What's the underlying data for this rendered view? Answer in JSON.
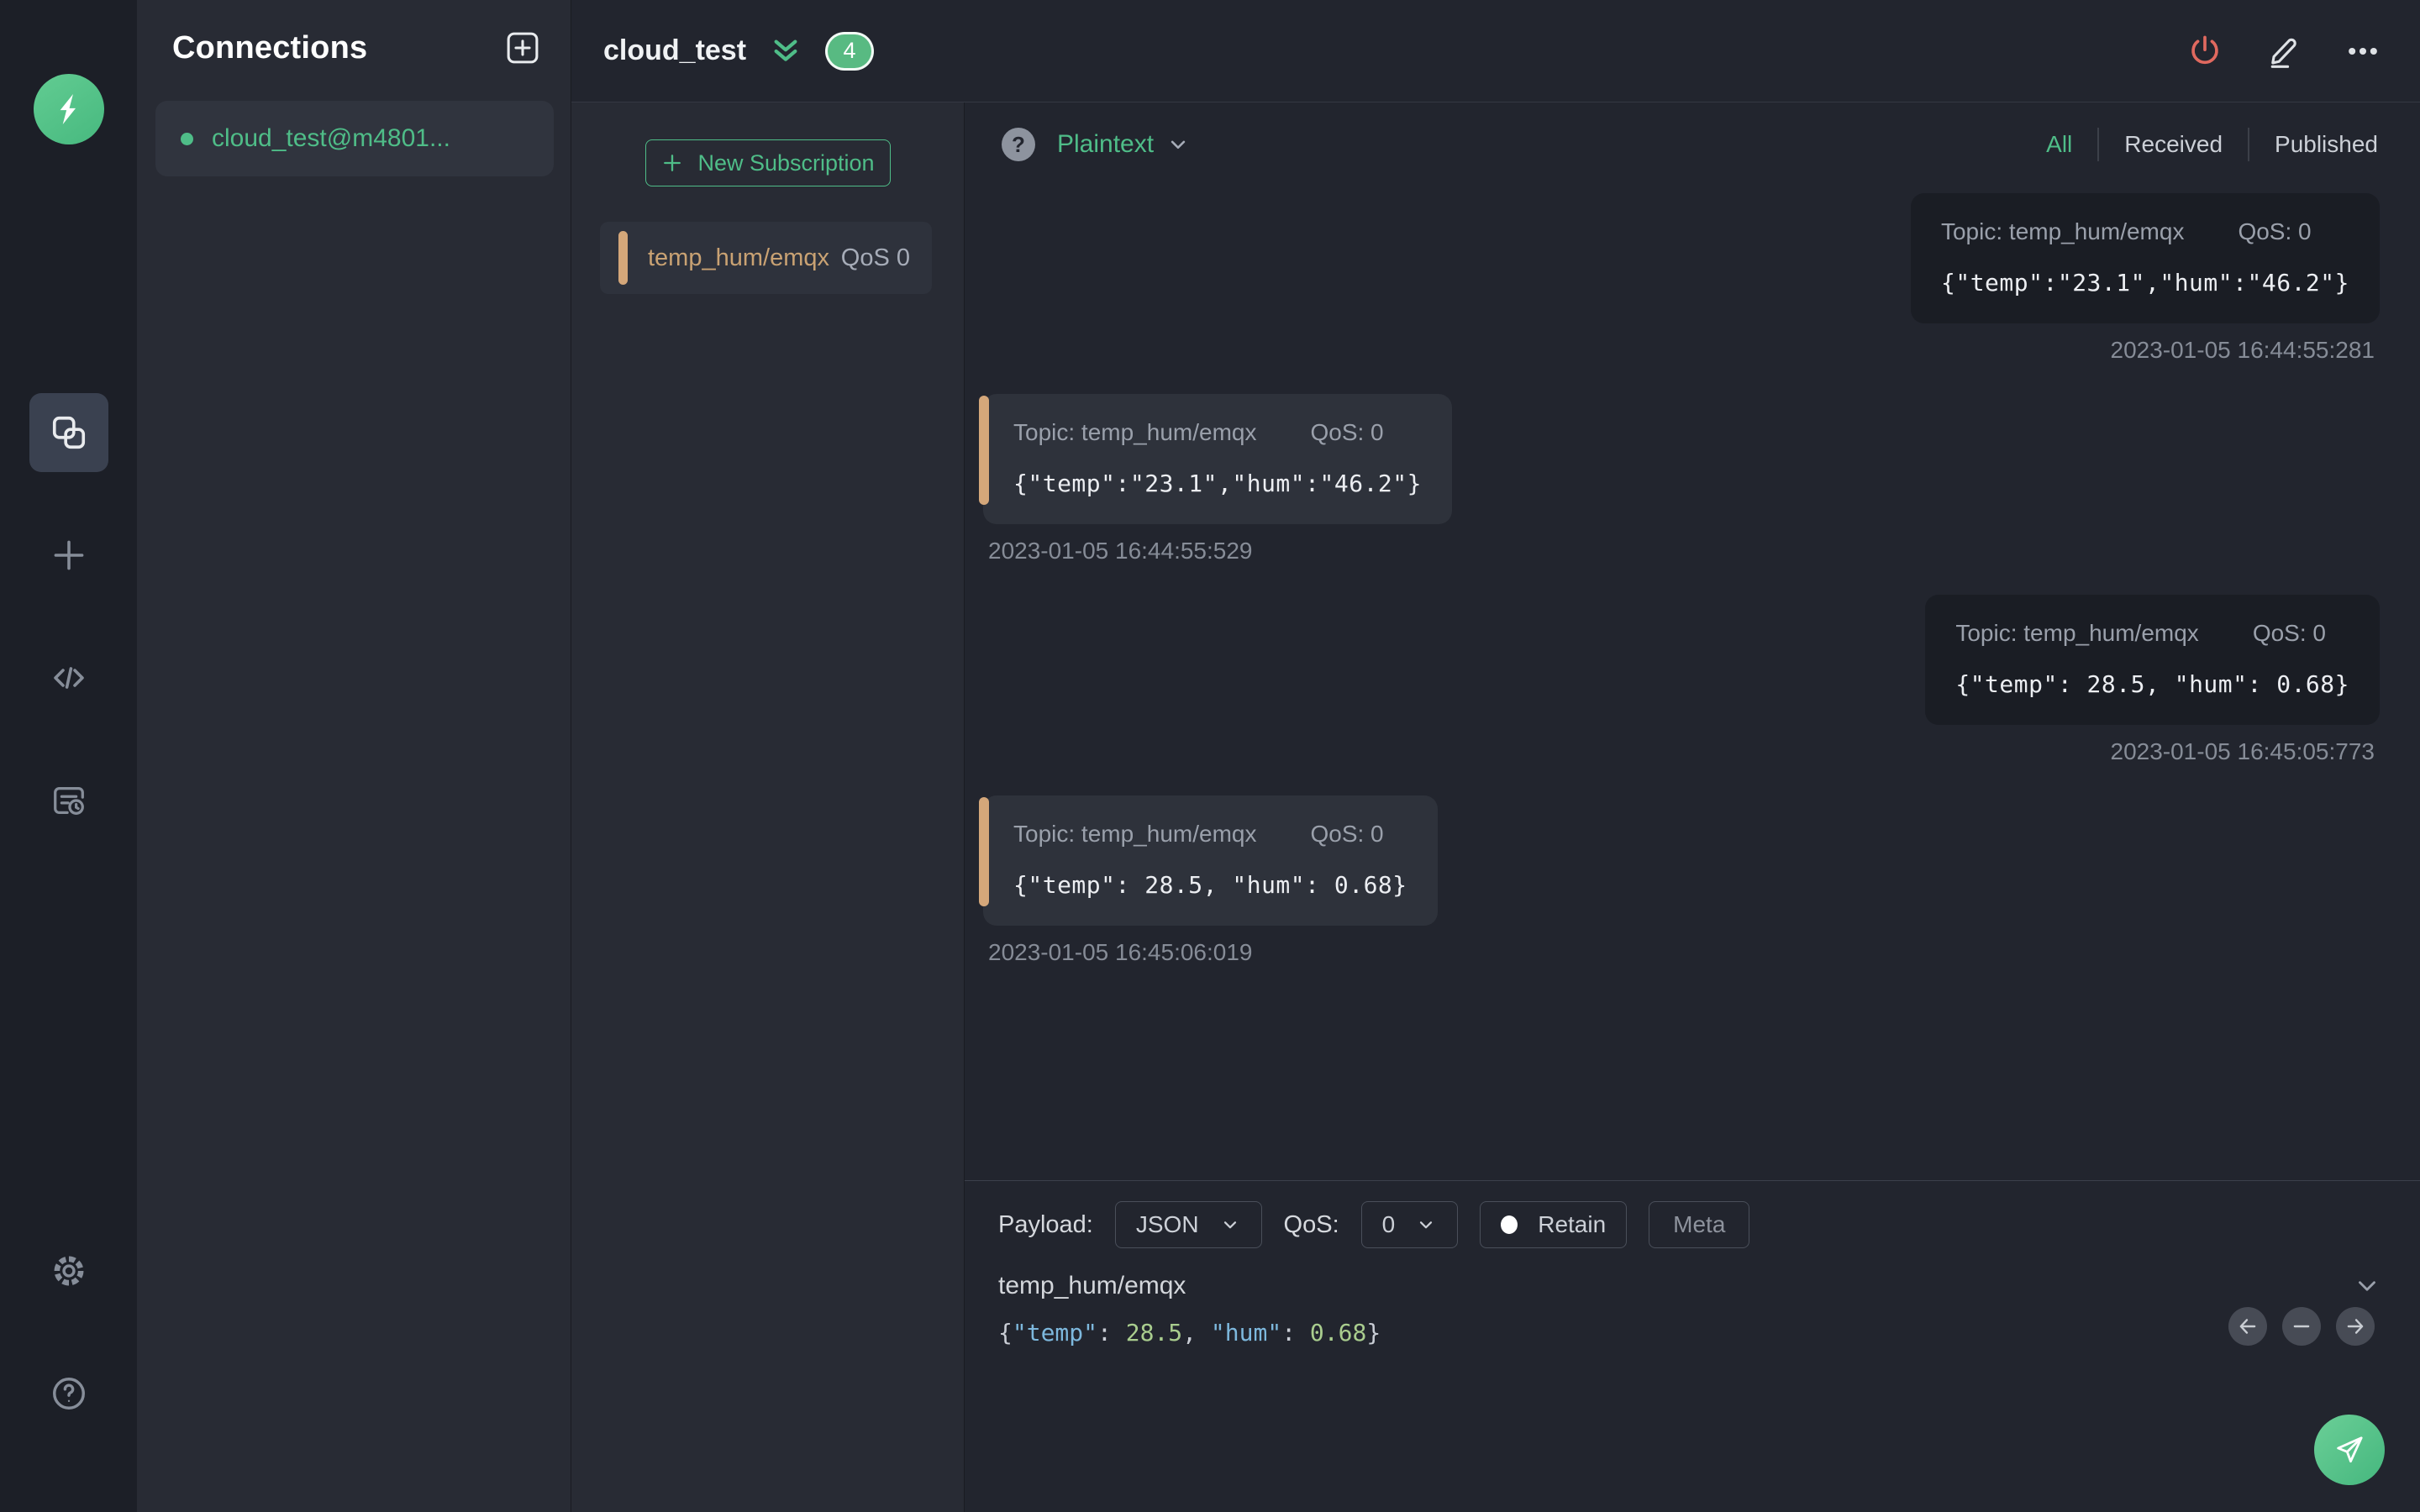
{
  "colors": {
    "accent_green": "#4fbd88",
    "accent_orange": "#d4a77a",
    "danger_red": "#e0695f"
  },
  "connections": {
    "title": "Connections",
    "items": [
      {
        "name": "cloud_test@m4801...",
        "status": "connected"
      }
    ]
  },
  "header": {
    "title": "cloud_test",
    "badge_count": "4"
  },
  "subscriptions": {
    "new_button_label": "New Subscription",
    "items": [
      {
        "topic": "temp_hum/emqx",
        "qos_label": "QoS 0"
      }
    ]
  },
  "messages": {
    "help_glyph": "?",
    "payload_format": "Plaintext",
    "tabs": [
      {
        "label": "All",
        "active": true
      },
      {
        "label": "Received",
        "active": false
      },
      {
        "label": "Published",
        "active": false
      }
    ],
    "items": [
      {
        "direction": "published",
        "topic_label": "Topic: temp_hum/emqx",
        "qos_label": "QoS: 0",
        "payload": "{\"temp\":\"23.1\",\"hum\":\"46.2\"}",
        "timestamp": "2023-01-05 16:44:55:281"
      },
      {
        "direction": "received",
        "topic_label": "Topic: temp_hum/emqx",
        "qos_label": "QoS: 0",
        "payload": "{\"temp\":\"23.1\",\"hum\":\"46.2\"}",
        "timestamp": "2023-01-05 16:44:55:529"
      },
      {
        "direction": "published",
        "topic_label": "Topic: temp_hum/emqx",
        "qos_label": "QoS: 0",
        "payload": "{\"temp\": 28.5, \"hum\": 0.68}",
        "timestamp": "2023-01-05 16:45:05:773"
      },
      {
        "direction": "received",
        "topic_label": "Topic: temp_hum/emqx",
        "qos_label": "QoS: 0",
        "payload": "{\"temp\": 28.5, \"hum\": 0.68}",
        "timestamp": "2023-01-05 16:45:06:019"
      }
    ]
  },
  "publish": {
    "payload_label": "Payload:",
    "payload_type": "JSON",
    "qos_label": "QoS:",
    "qos_value": "0",
    "retain_label": "Retain",
    "meta_label": "Meta",
    "topic_value": "temp_hum/emqx",
    "payload_tokens": {
      "open": "{",
      "key_temp": "\"temp\"",
      "colon1": ": ",
      "val_temp": "28.5",
      "sep": ", ",
      "key_hum": "\"hum\"",
      "colon2": ": ",
      "val_hum": "0.68",
      "close": "}"
    }
  }
}
